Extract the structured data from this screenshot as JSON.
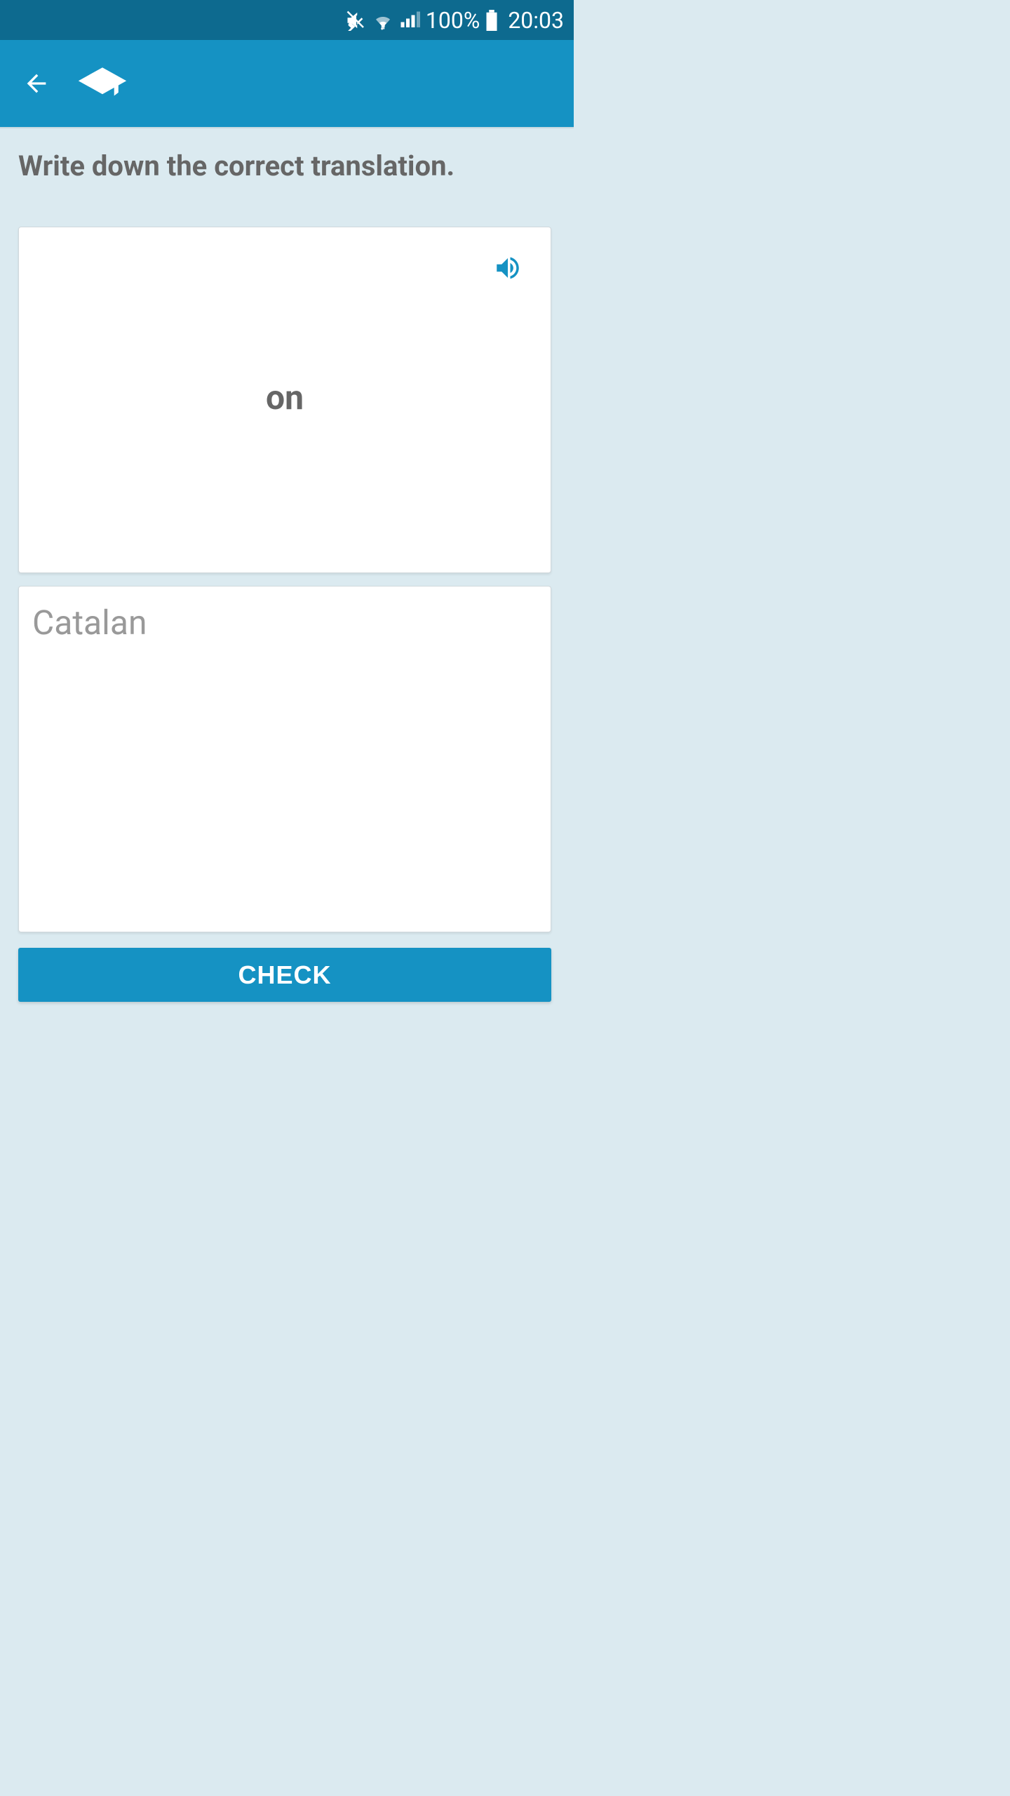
{
  "status_bar": {
    "battery_percent": "100%",
    "time": "20:03"
  },
  "instruction": "Write down the correct translation.",
  "word_card": {
    "word": "on"
  },
  "answer_input": {
    "placeholder": "Catalan",
    "value": ""
  },
  "check_button": {
    "label": "CHECK"
  }
}
